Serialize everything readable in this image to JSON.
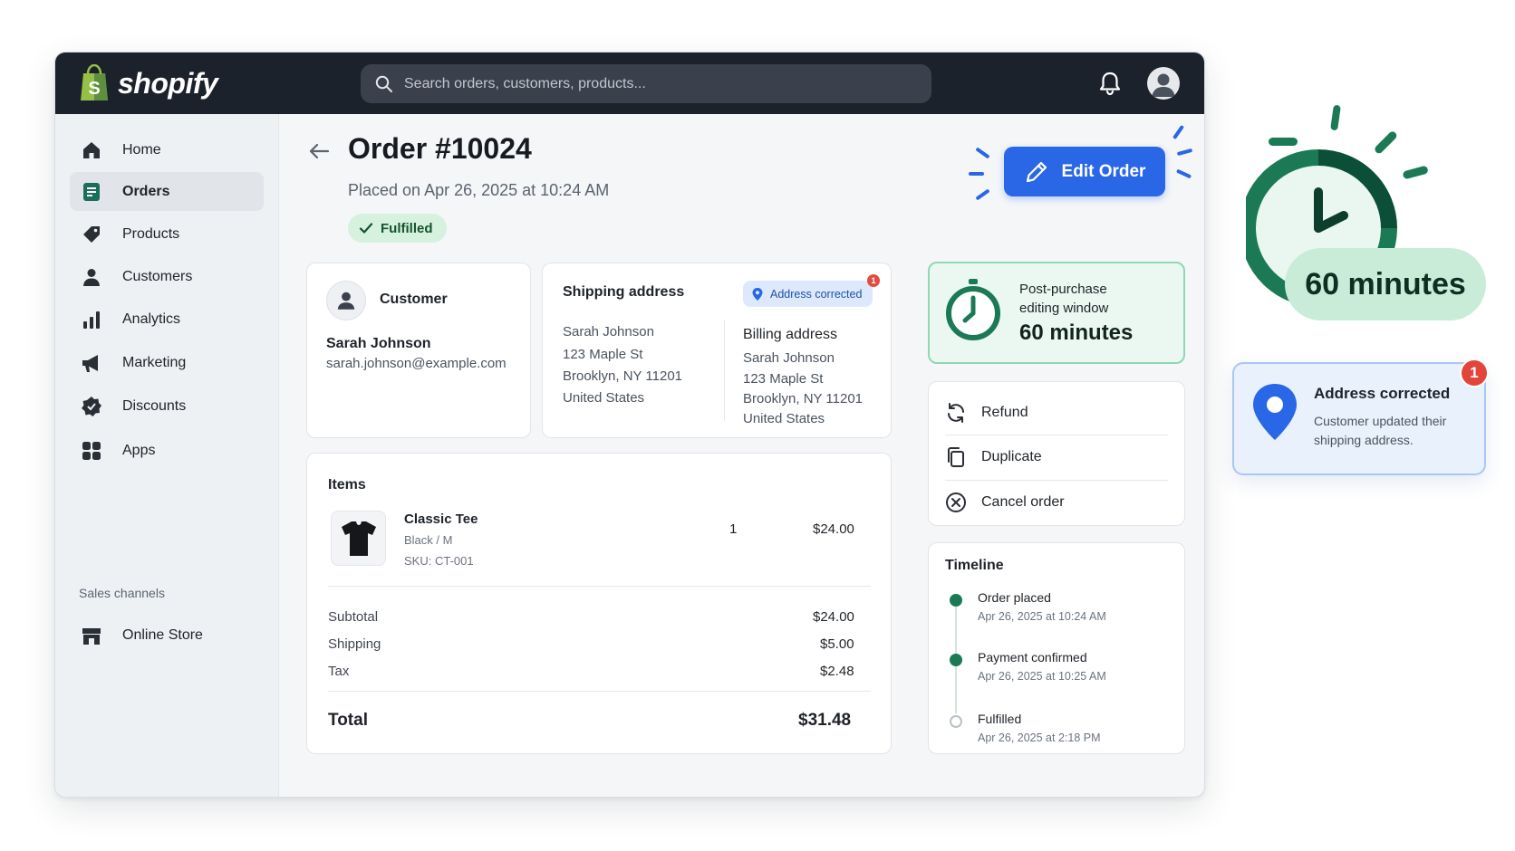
{
  "topbar": {
    "brand": "shopify",
    "search_placeholder": "Search orders, customers, products..."
  },
  "sidebar": {
    "items": [
      {
        "label": "Home",
        "icon": "home-icon"
      },
      {
        "label": "Orders",
        "icon": "orders-icon",
        "active": true
      },
      {
        "label": "Products",
        "icon": "tag-icon"
      },
      {
        "label": "Customers",
        "icon": "person-icon"
      },
      {
        "label": "Analytics",
        "icon": "bar-chart-icon"
      },
      {
        "label": "Marketing",
        "icon": "megaphone-icon"
      },
      {
        "label": "Discounts",
        "icon": "discount-badge-icon"
      },
      {
        "label": "Apps",
        "icon": "apps-grid-icon"
      }
    ],
    "section_label": "Sales channels",
    "channels": [
      {
        "label": "Online Store",
        "icon": "store-icon"
      }
    ]
  },
  "order": {
    "title": "Order #10024",
    "placed": "Placed on Apr 26, 2025 at 10:24 AM",
    "status": "Fulfilled",
    "edit_label": "Edit Order"
  },
  "customer": {
    "heading": "Customer",
    "name": "Sarah Johnson",
    "email": "sarah.johnson@example.com"
  },
  "shipping": {
    "heading": "Shipping address",
    "pill": "Address corrected",
    "pill_count": "1",
    "lines": [
      "Sarah Johnson",
      "123 Maple St",
      "Brooklyn, NY 11201",
      "United States"
    ]
  },
  "billing": {
    "heading": "Billing address",
    "lines": [
      "Sarah Johnson",
      "123 Maple St",
      "Brooklyn, NY 11201",
      "United States"
    ]
  },
  "items": {
    "heading": "Items",
    "list": [
      {
        "name": "Classic Tee",
        "variant": "Black / M",
        "sku": "SKU: CT-001",
        "qty": "1",
        "price": "$24.00"
      }
    ],
    "summary": [
      {
        "label": "Subtotal",
        "value": "$24.00"
      },
      {
        "label": "Shipping",
        "value": "$5.00"
      },
      {
        "label": "Tax",
        "value": "$2.48"
      }
    ],
    "total_label": "Total",
    "total_value": "$31.48"
  },
  "editing_window": {
    "label_line1": "Post-purchase",
    "label_line2": "editing window",
    "value": "60 minutes"
  },
  "actions": [
    {
      "label": "Refund",
      "icon": "refresh-icon"
    },
    {
      "label": "Duplicate",
      "icon": "duplicate-icon"
    },
    {
      "label": "Cancel order",
      "icon": "cancel-circle-icon"
    }
  ],
  "timeline": {
    "heading": "Timeline",
    "events": [
      {
        "title": "Order placed",
        "time": "Apr 26, 2025 at 10:24 AM",
        "done": true
      },
      {
        "title": "Payment confirmed",
        "time": "Apr 26, 2025 at 10:25 AM",
        "done": true
      },
      {
        "title": "Fulfilled",
        "time": "Apr 26, 2025 at 2:18 PM",
        "done": false
      }
    ]
  },
  "callouts": {
    "timer_value": "60 minutes",
    "notification_title": "Address corrected",
    "notification_body": "Customer updated their shipping address.",
    "notification_count": "1"
  },
  "colors": {
    "topbar": "#1c222b",
    "accent_blue": "#2a67e6",
    "success_green": "#1b7a55",
    "badge_red": "#e14d3e"
  }
}
